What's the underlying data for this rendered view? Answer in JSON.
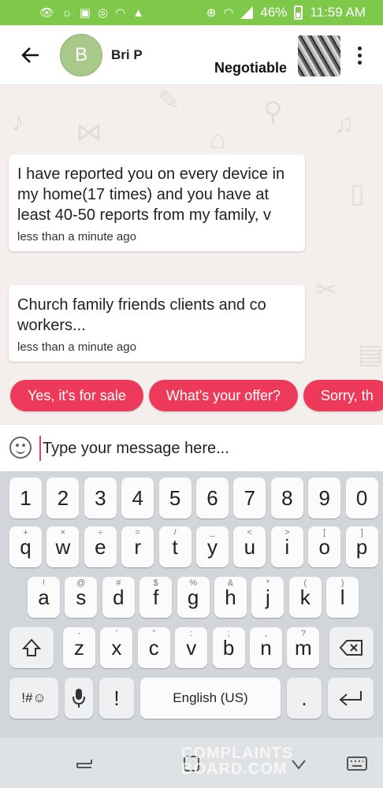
{
  "status_bar": {
    "battery": "46%",
    "time": "11:59 AM",
    "color": "#7fc94a"
  },
  "header": {
    "avatar_initial": "B",
    "name": "Bri P",
    "price": "Negotiable"
  },
  "messages": [
    {
      "text": "I have reported you on every device in my home(17 times) and you have at least 40-50 reports from my family, v",
      "time": "less than a minute ago"
    },
    {
      "text": "Church family friends clients and co workers...",
      "time": "less than a minute ago"
    }
  ],
  "quick_replies": [
    "Yes, it's for sale",
    "What's your offer?",
    "Sorry, th"
  ],
  "composer": {
    "placeholder": "Type your message here..."
  },
  "keyboard": {
    "row_numbers": [
      "1",
      "2",
      "3",
      "4",
      "5",
      "6",
      "7",
      "8",
      "9",
      "0"
    ],
    "row_top": [
      {
        "k": "q",
        "s": "+"
      },
      {
        "k": "w",
        "s": "×"
      },
      {
        "k": "e",
        "s": "÷"
      },
      {
        "k": "r",
        "s": "="
      },
      {
        "k": "t",
        "s": "/"
      },
      {
        "k": "y",
        "s": "_"
      },
      {
        "k": "u",
        "s": "<"
      },
      {
        "k": "i",
        "s": ">"
      },
      {
        "k": "o",
        "s": "["
      },
      {
        "k": "p",
        "s": "]"
      }
    ],
    "row_mid": [
      {
        "k": "a",
        "s": "!"
      },
      {
        "k": "s",
        "s": "@"
      },
      {
        "k": "d",
        "s": "#"
      },
      {
        "k": "f",
        "s": "$"
      },
      {
        "k": "g",
        "s": "%"
      },
      {
        "k": "h",
        "s": "&"
      },
      {
        "k": "j",
        "s": "*"
      },
      {
        "k": "k",
        "s": "("
      },
      {
        "k": "l",
        "s": ")"
      }
    ],
    "row_bottom": [
      {
        "k": "z",
        "s": "-"
      },
      {
        "k": "x",
        "s": "'"
      },
      {
        "k": "c",
        "s": "\""
      },
      {
        "k": "v",
        "s": ":"
      },
      {
        "k": "b",
        "s": ";"
      },
      {
        "k": "n",
        "s": ","
      },
      {
        "k": "m",
        "s": "?"
      }
    ],
    "symbols_label": "!#☺",
    "exclaim_label": "!",
    "space_label": "English (US)",
    "period_label": "."
  },
  "watermark": {
    "line1": "COMPLAINTS",
    "line2": "BOARD.COM"
  },
  "accent_color": "#ee3a5a"
}
